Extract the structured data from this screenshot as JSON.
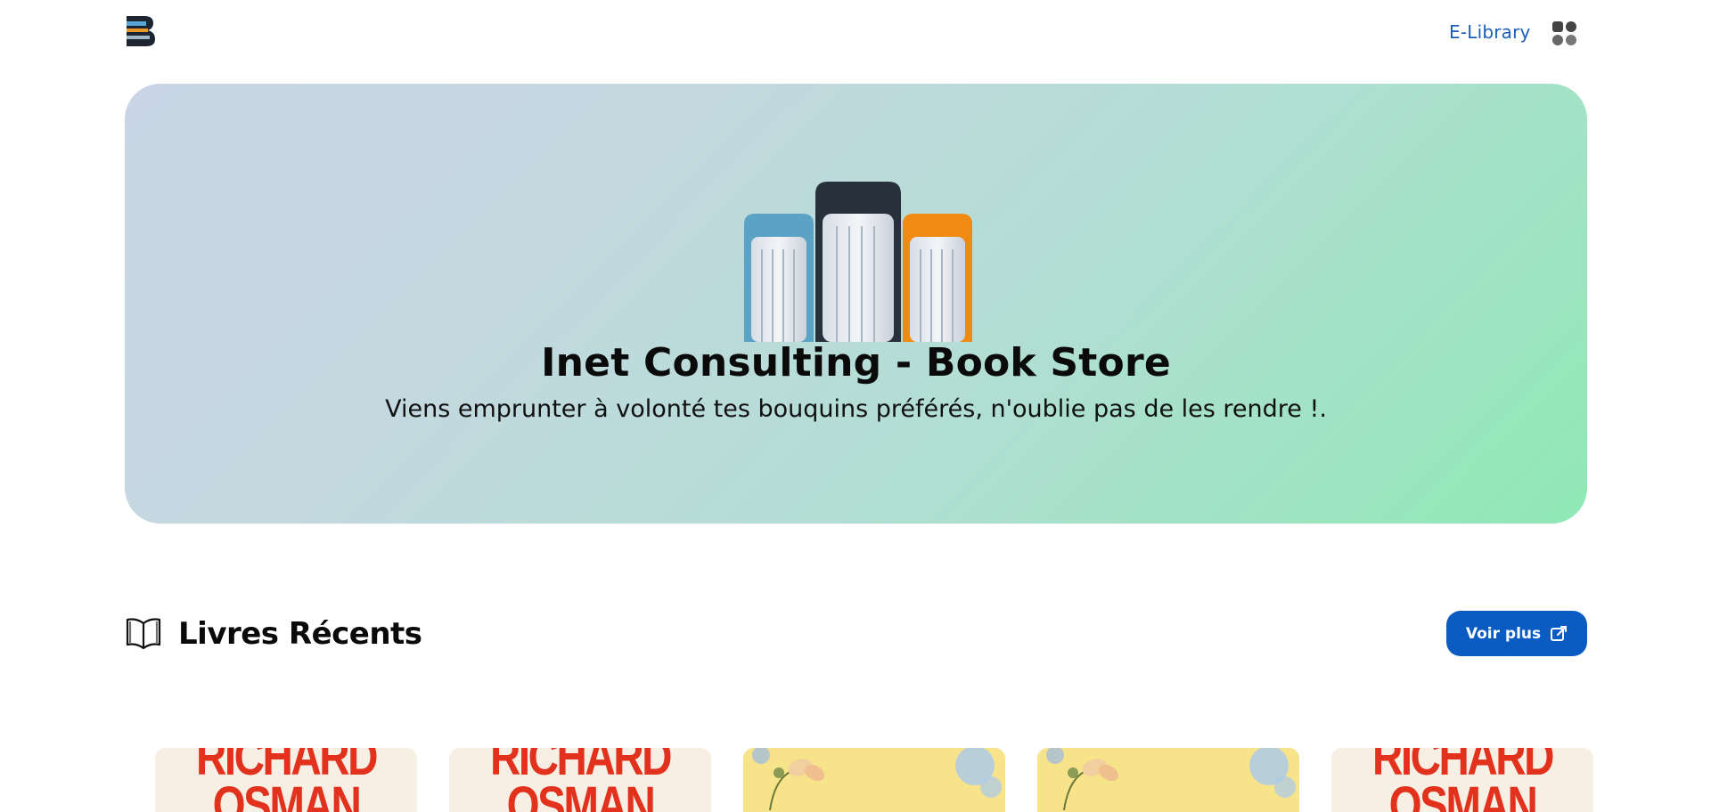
{
  "header": {
    "logo_alt": "B",
    "nav_link": "E-Library",
    "apps_icon": "apps-grid-icon"
  },
  "hero": {
    "title": "Inet Consulting - Book Store",
    "subtitle": "Viens emprunter à volonté tes bouquins préférés, n'oublie pas de les rendre !.",
    "gradient_start": "#c9d5e5",
    "gradient_end": "#8fe8b5"
  },
  "section": {
    "icon": "open-book-icon",
    "title": "Livres Récents",
    "more_button": "Voir plus",
    "more_button_icon": "external-edit-icon",
    "accent": "#0b5cc2"
  },
  "books": [
    {
      "cover": "osman",
      "cover_text": "RICHARD OSMAN"
    },
    {
      "cover": "osman",
      "cover_text": "RICHARD OSMAN"
    },
    {
      "cover": "flower"
    },
    {
      "cover": "flower"
    },
    {
      "cover": "osman",
      "cover_text": "RICHARD OSMAN"
    }
  ]
}
